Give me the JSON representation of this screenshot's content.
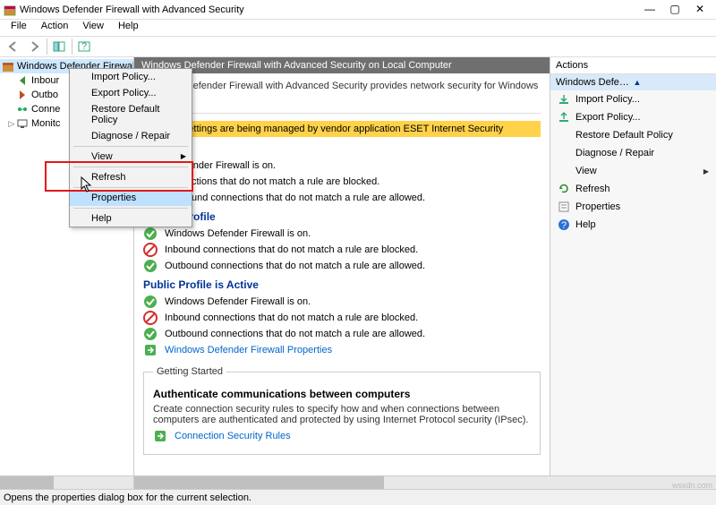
{
  "window_title": "Windows Defender Firewall with Advanced Security",
  "menubar": [
    "File",
    "Action",
    "View",
    "Help"
  ],
  "tree": {
    "root": "Windows Defender Firewall with",
    "items": [
      "Inbour",
      "Outbo",
      "Conne",
      "Monitc"
    ]
  },
  "main_header": "Windows Defender Firewall with Advanced Security on Local Computer",
  "intro": "Windows Defender Firewall with Advanced Security provides network security for Windows computers.",
  "warning": "ese settings are being managed by vendor application ESET Internet Security",
  "domain_profile": {
    "title": "ofile",
    "rows": [
      "s Defender Firewall is on.",
      "connections that do not match a rule are blocked.",
      "Outbound connections that do not match a rule are allowed."
    ]
  },
  "private_profile": {
    "title": "Private Profile",
    "rows": [
      "Windows Defender Firewall is on.",
      "Inbound connections that do not match a rule are blocked.",
      "Outbound connections that do not match a rule are allowed."
    ]
  },
  "public_profile": {
    "title": "Public Profile is Active",
    "rows": [
      "Windows Defender Firewall is on.",
      "Inbound connections that do not match a rule are blocked.",
      "Outbound connections that do not match a rule are allowed."
    ]
  },
  "properties_link": "Windows Defender Firewall Properties",
  "getting_started": {
    "legend": "Getting Started",
    "heading": "Authenticate communications between computers",
    "text": "Create connection security rules to specify how and when connections between computers are authenticated and protected by using Internet Protocol security (IPsec).",
    "link": "Connection Security Rules"
  },
  "actions": {
    "pane_title": "Actions",
    "group_title": "Windows Defender Firewall with Advan...",
    "items": [
      "Import Policy...",
      "Export Policy...",
      "Restore Default Policy",
      "Diagnose / Repair",
      "View",
      "Refresh",
      "Properties",
      "Help"
    ]
  },
  "context_menu": {
    "items": [
      "Import Policy...",
      "Export Policy...",
      "Restore Default Policy",
      "Diagnose / Repair",
      "View",
      "Refresh",
      "Properties",
      "Help"
    ]
  },
  "status": "Opens the properties dialog box for the current selection.",
  "watermark": "wsxdn.com"
}
